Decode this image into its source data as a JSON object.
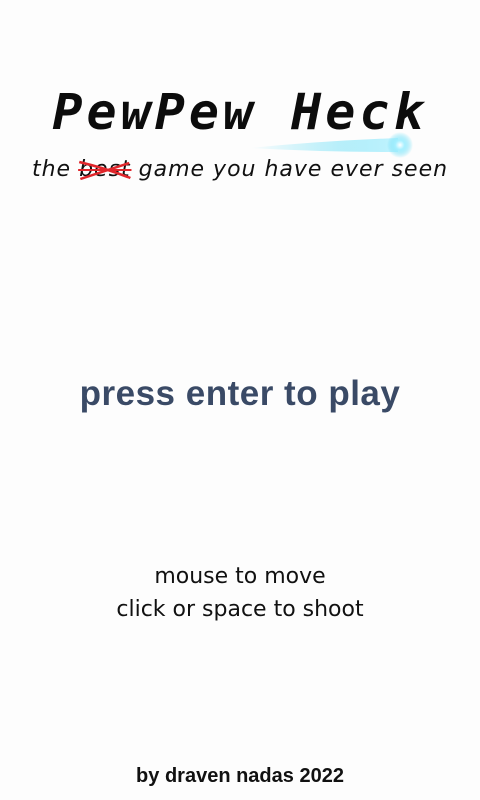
{
  "title": "PewPew Heck",
  "tagline": {
    "before": "the ",
    "struck_word": "best",
    "after": " game you have ever seen"
  },
  "prompt": "press enter to play",
  "instructions": [
    "mouse to move",
    "click or space to shoot"
  ],
  "credit": "by draven nadas 2022",
  "colors": {
    "background": "#fdfdfd",
    "title": "#0c0c0c",
    "prompt": "#3a4a66",
    "strike": "#e0262b",
    "comet": "#5ad8f2"
  }
}
